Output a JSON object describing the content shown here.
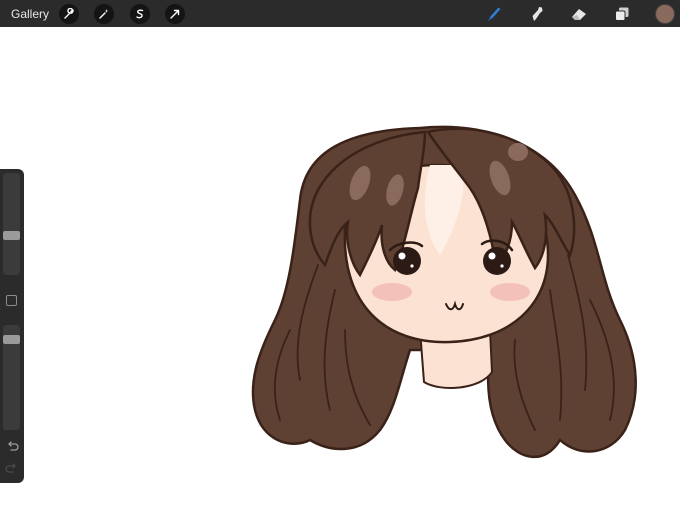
{
  "topbar": {
    "gallery_label": "Gallery",
    "left_tools": [
      "wrench-icon",
      "magic-wand-icon",
      "selection-icon",
      "transform-icon"
    ],
    "right_tools": [
      "brush-icon",
      "smudge-icon",
      "eraser-icon",
      "layers-icon"
    ],
    "active_tool": "brush-icon",
    "current_color": "#8a6a5c"
  },
  "sidebar": {
    "brush_size_level": 0.38,
    "opacity_level": 0.9,
    "buttons": [
      "modify-button",
      "undo-icon",
      "redo-icon"
    ]
  },
  "colors": {
    "toolbar": "#2b2b2b",
    "hair": "#5e4133",
    "hair_outline": "#3a2219",
    "skin": "#fbe2d2",
    "blush": "#f3b8b4",
    "active_brush": "#2f7fd8"
  }
}
